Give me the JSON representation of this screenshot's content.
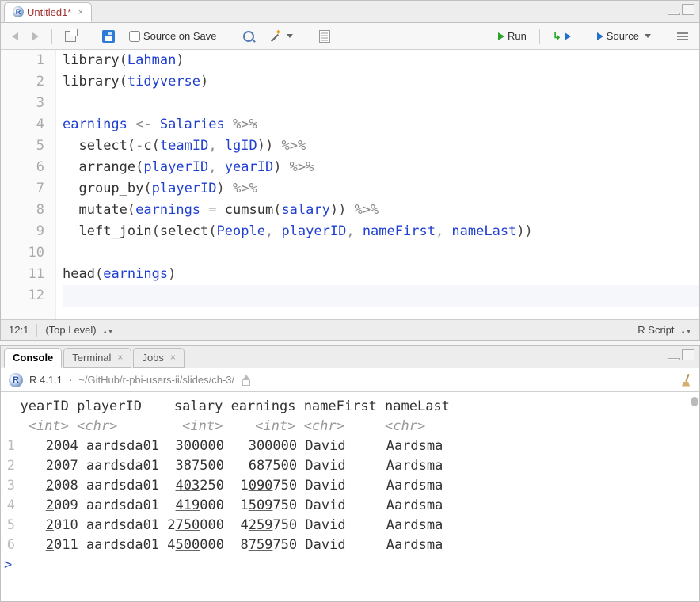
{
  "source": {
    "tab_title": "Untitled1*",
    "toolbar": {
      "source_on_save": "Source on Save",
      "run": "Run",
      "source": "Source"
    },
    "code": {
      "lines": [
        {
          "n": "1",
          "tokens": [
            [
              "fn",
              "library"
            ],
            [
              "paren",
              "("
            ],
            [
              "kw",
              "Lahman"
            ],
            [
              "paren",
              ")"
            ]
          ]
        },
        {
          "n": "2",
          "tokens": [
            [
              "fn",
              "library"
            ],
            [
              "paren",
              "("
            ],
            [
              "kw",
              "tidyverse"
            ],
            [
              "paren",
              ")"
            ]
          ]
        },
        {
          "n": "3",
          "tokens": []
        },
        {
          "n": "4",
          "tokens": [
            [
              "kw",
              "earnings"
            ],
            [
              "op",
              " <- "
            ],
            [
              "kw",
              "Salaries"
            ],
            [
              "op",
              " %>%"
            ]
          ]
        },
        {
          "n": "5",
          "tokens": [
            [
              "",
              "  "
            ],
            [
              "fn",
              "select"
            ],
            [
              "paren",
              "("
            ],
            [
              "op",
              "-"
            ],
            [
              "fn",
              "c"
            ],
            [
              "paren",
              "("
            ],
            [
              "kw",
              "teamID"
            ],
            [
              "op",
              ", "
            ],
            [
              "kw",
              "lgID"
            ],
            [
              "paren",
              "))"
            ],
            [
              "op",
              " %>%"
            ]
          ]
        },
        {
          "n": "6",
          "tokens": [
            [
              "",
              "  "
            ],
            [
              "fn",
              "arrange"
            ],
            [
              "paren",
              "("
            ],
            [
              "kw",
              "playerID"
            ],
            [
              "op",
              ", "
            ],
            [
              "kw",
              "yearID"
            ],
            [
              "paren",
              ")"
            ],
            [
              "op",
              " %>%"
            ]
          ]
        },
        {
          "n": "7",
          "tokens": [
            [
              "",
              "  "
            ],
            [
              "fn",
              "group_by"
            ],
            [
              "paren",
              "("
            ],
            [
              "kw",
              "playerID"
            ],
            [
              "paren",
              ")"
            ],
            [
              "op",
              " %>%"
            ]
          ]
        },
        {
          "n": "8",
          "tokens": [
            [
              "",
              "  "
            ],
            [
              "fn",
              "mutate"
            ],
            [
              "paren",
              "("
            ],
            [
              "kw",
              "earnings"
            ],
            [
              "op",
              " = "
            ],
            [
              "fn",
              "cumsum"
            ],
            [
              "paren",
              "("
            ],
            [
              "kw",
              "salary"
            ],
            [
              "paren",
              "))"
            ],
            [
              "op",
              " %>%"
            ]
          ]
        },
        {
          "n": "9",
          "tokens": [
            [
              "",
              "  "
            ],
            [
              "fn",
              "left_join"
            ],
            [
              "paren",
              "("
            ],
            [
              "fn",
              "select"
            ],
            [
              "paren",
              "("
            ],
            [
              "kw",
              "People"
            ],
            [
              "op",
              ", "
            ],
            [
              "kw",
              "playerID"
            ],
            [
              "op",
              ", "
            ],
            [
              "kw",
              "nameFirst"
            ],
            [
              "op",
              ", "
            ],
            [
              "kw",
              "nameLast"
            ],
            [
              "paren",
              "))"
            ]
          ]
        },
        {
          "n": "10",
          "tokens": []
        },
        {
          "n": "11",
          "tokens": [
            [
              "fn",
              "head"
            ],
            [
              "paren",
              "("
            ],
            [
              "kw",
              "earnings"
            ],
            [
              "paren",
              ")"
            ]
          ]
        },
        {
          "n": "12",
          "tokens": []
        }
      ]
    },
    "status": {
      "position": "12:1",
      "scope": "(Top Level)",
      "lang": "R Script"
    }
  },
  "console": {
    "tabs": {
      "console": "Console",
      "terminal": "Terminal",
      "jobs": "Jobs"
    },
    "header": {
      "version": "R 4.1.1",
      "path": "~/GitHub/r-pbi-users-ii/slides/ch-3/"
    },
    "output": {
      "cols_header": "  yearID playerID    salary earnings nameFirst nameLast",
      "cols": [
        "yearID",
        "playerID",
        "salary",
        "earnings",
        "nameFirst",
        "nameLast"
      ],
      "types_line": "   <int> <chr>        <int>    <int> <chr>     <chr>",
      "types": [
        "<int>",
        "<chr>",
        "<int>",
        "<int>",
        "<chr>",
        "<chr>"
      ],
      "rows": [
        {
          "n": "1",
          "yearID": "2004",
          "playerID": "aardsda01",
          "salary": "300000",
          "salary_u": "300",
          "earnings": "300000",
          "earn_u": "300",
          "nameFirst": "David",
          "nameLast": "Aardsma"
        },
        {
          "n": "2",
          "yearID": "2007",
          "playerID": "aardsda01",
          "salary": "387500",
          "salary_u": "387",
          "earnings": "687500",
          "earn_u": "687",
          "nameFirst": "David",
          "nameLast": "Aardsma"
        },
        {
          "n": "3",
          "yearID": "2008",
          "playerID": "aardsda01",
          "salary": "403250",
          "salary_u": "403",
          "earnings": "1090750",
          "earn_u": "090",
          "nameFirst": "David",
          "nameLast": "Aardsma"
        },
        {
          "n": "4",
          "yearID": "2009",
          "playerID": "aardsda01",
          "salary": "419000",
          "salary_u": "419",
          "earnings": "1509750",
          "earn_u": "509",
          "nameFirst": "David",
          "nameLast": "Aardsma"
        },
        {
          "n": "5",
          "yearID": "2010",
          "playerID": "aardsda01",
          "salary": "2750000",
          "salary_u": "750",
          "earnings": "4259750",
          "earn_u": "259",
          "nameFirst": "David",
          "nameLast": "Aardsma"
        },
        {
          "n": "6",
          "yearID": "2011",
          "playerID": "aardsda01",
          "salary": "4500000",
          "salary_u": "500",
          "earnings": "8759750",
          "earn_u": "759",
          "nameFirst": "David",
          "nameLast": "Aardsma"
        }
      ],
      "prompt": ">"
    }
  }
}
